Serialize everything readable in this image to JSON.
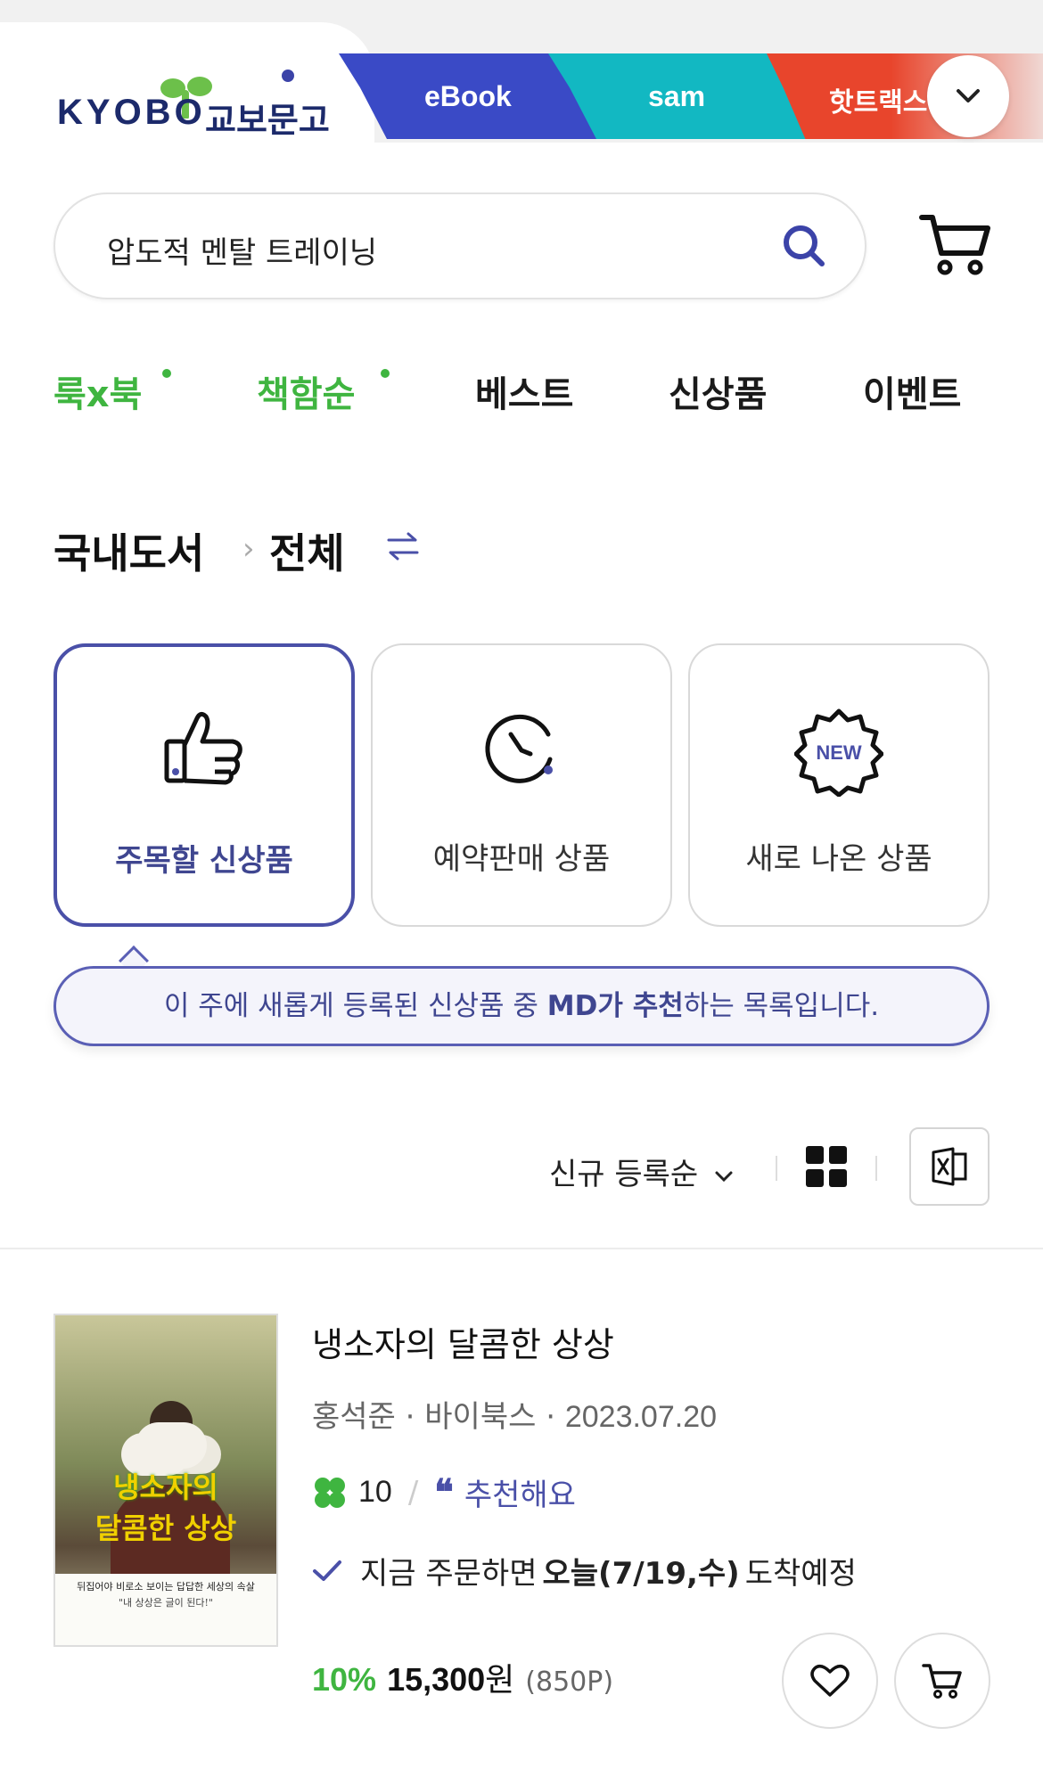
{
  "header": {
    "logo_text": "KYOBO",
    "logo_kr": "교보문고",
    "tabs": [
      {
        "label": "eBook"
      },
      {
        "label": "sam"
      },
      {
        "label": "핫트랙스"
      }
    ]
  },
  "search": {
    "value": "압도적 멘탈 트레이닝"
  },
  "nav": [
    {
      "label": "룩x북"
    },
    {
      "label": "책함순"
    },
    {
      "label": "베스트"
    },
    {
      "label": "신상품"
    },
    {
      "label": "이벤트"
    }
  ],
  "breadcrumb": {
    "level1": "국내도서",
    "separator": "›",
    "level2": "전체"
  },
  "categories": [
    {
      "label": "주목할 신상품",
      "icon": "thumbs-up-icon",
      "active": true
    },
    {
      "label": "예약판매 상품",
      "icon": "clock-icon",
      "active": false
    },
    {
      "label": "새로 나온 상품",
      "icon": "new-badge-icon",
      "active": false
    }
  ],
  "tooltip": {
    "pre": "이 주에 새롭게 등록된 신상품 중 ",
    "bold": "MD가 추천",
    "post": "하는 목록입니다."
  },
  "toolbar": {
    "sort_label": "신규 등록순"
  },
  "product": {
    "title": "냉소자의 달콤한 상상",
    "author": "홍석준",
    "publisher": "바이북스",
    "date": "2023.07.20",
    "meta_sep": " · ",
    "score": "10",
    "slash": "/",
    "recommend": "추천해요",
    "delivery_pre": "지금 주문하면",
    "delivery_bold": "오늘(7/19,수)",
    "delivery_post": "도착예정",
    "discount": "10%",
    "price": "15,300",
    "won": "원",
    "points": "(850P)",
    "cover": {
      "title_line1": "냉소자의",
      "title_line2": "달콤한 상상",
      "subtitle": "뒤집어야 비로소 보이는 답답한 세상의 속살",
      "tagline": "\"내 상상은 글이 된다!\""
    }
  },
  "colors": {
    "brand_navy": "#1c2a6b",
    "ebook_blue": "#3a4ac6",
    "sam_teal": "#12b8c2",
    "hot_red": "#e8452c",
    "accent_green": "#3fb540",
    "accent_indigo": "#4a50a8"
  }
}
